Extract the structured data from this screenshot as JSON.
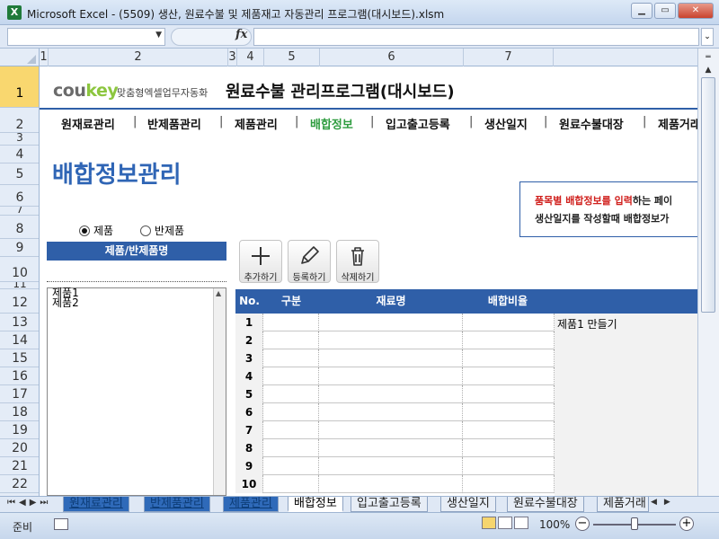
{
  "window": {
    "app_icon": "X",
    "title": "Microsoft Excel - (5509) 생산, 원료수불 및 제품재고 자동관리 프로그램(대시보드).xlsm",
    "min_icon": "minimize-icon",
    "max_icon": "maximize-icon",
    "close_icon": "close-icon",
    "min_glyph": "▁",
    "max_glyph": "▭",
    "close_glyph": "✕"
  },
  "formula_bar": {
    "name_box_value": "",
    "fx_label": "fx",
    "formula_value": ""
  },
  "columns": [
    "1",
    "2",
    "3",
    "4",
    "5",
    "6",
    "7"
  ],
  "rows": [
    "1",
    "2",
    "3",
    "4",
    "5",
    "6",
    "7",
    "8",
    "9",
    "10",
    "11",
    "12",
    "13",
    "14",
    "15",
    "16",
    "17",
    "18",
    "19",
    "20",
    "21",
    "22"
  ],
  "header": {
    "logo_main": "cou",
    "logo_accent": "key",
    "logo_sub": "맞춤형엑셀업무자동화",
    "program_title": "원료수불 관리프로그램(대시보드)"
  },
  "nav": {
    "items": [
      "원재료관리",
      "반제품관리",
      "제품관리",
      "배합정보",
      "입고출고등록",
      "생산일지",
      "원료수불대장",
      "제품거래"
    ],
    "active_index": 3
  },
  "page_title": "배합정보관리",
  "info_box": {
    "highlight": "품목별 배합정보를 입력",
    "rest_line1": "하는 페이",
    "line2": "생산일지를 작성할때 배합정보가"
  },
  "radios": {
    "option1": "제품",
    "option2": "반제품",
    "selected": "제품"
  },
  "list": {
    "header": "제품/반제품명",
    "items": [
      "제품1",
      "제품2"
    ]
  },
  "toolbar": {
    "add_label": "추가하기",
    "register_label": "등록하기",
    "delete_label": "삭제하기",
    "add_icon": "plus-icon",
    "register_icon": "pencil-icon",
    "delete_icon": "trash-icon"
  },
  "grid": {
    "columns": [
      "No.",
      "구분",
      "재료명",
      "배합비율"
    ],
    "row_numbers": [
      "1",
      "2",
      "3",
      "4",
      "5",
      "6",
      "7",
      "8",
      "9",
      "10"
    ],
    "side_note": "제품1 만들기"
  },
  "sheet_tabs": {
    "tabs": [
      "원재료관리",
      "반제품관리",
      "제품관리",
      "배합정보",
      "입고출고등록",
      "생산일지",
      "원료수불대장",
      "제품거래"
    ],
    "active": "배합정보"
  },
  "status": {
    "ready": "준비",
    "zoom": "100%",
    "zoom_minus": "−",
    "zoom_plus": "+"
  }
}
